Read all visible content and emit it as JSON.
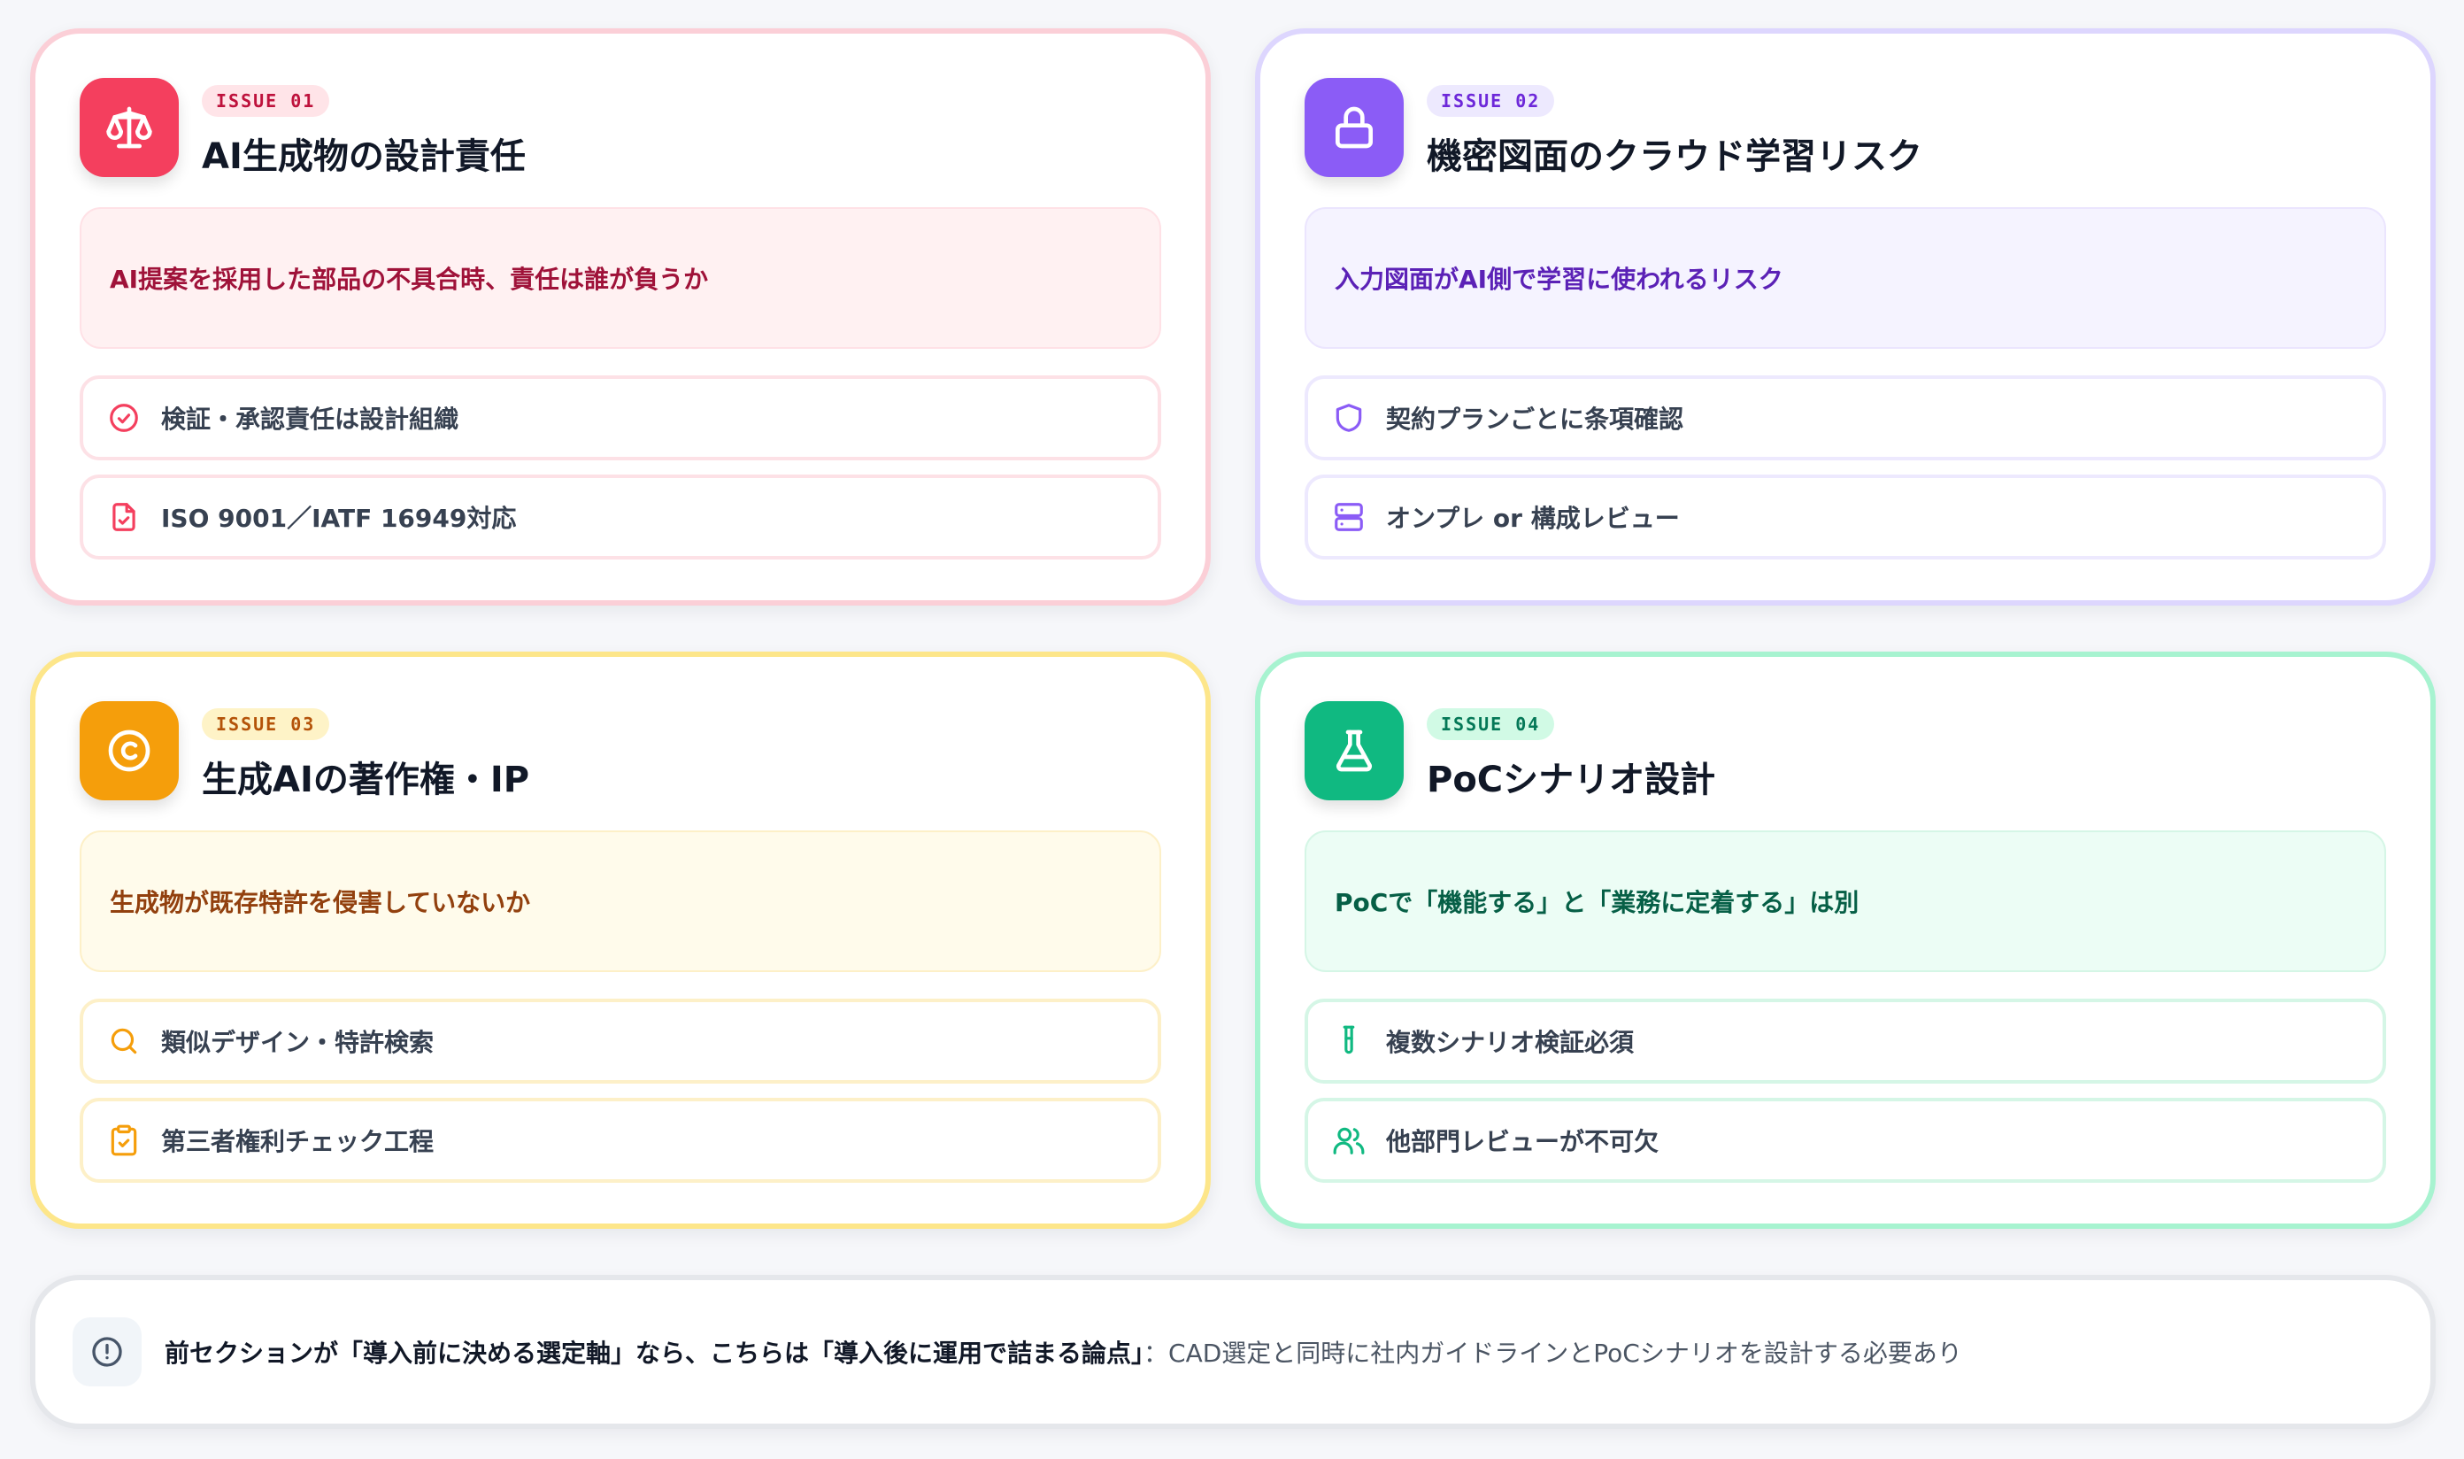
{
  "colors": {
    "issue01": "#f43f5e",
    "issue02": "#8b5cf6",
    "issue03": "#f59e0b",
    "issue04": "#10b981"
  },
  "cards": [
    {
      "badge": "ISSUE 01",
      "title": "AI生成物の設計責任",
      "icon": "scale-icon",
      "highlight": "AI提案を採用した部品の不具合時、責任は誰が負うか",
      "points": [
        {
          "icon": "check-circle-icon",
          "text": "検証・承認責任は設計組織"
        },
        {
          "icon": "file-check-icon",
          "text": "ISO 9001／IATF 16949対応"
        }
      ]
    },
    {
      "badge": "ISSUE 02",
      "title": "機密図面のクラウド学習リスク",
      "icon": "lock-icon",
      "highlight": "入力図面がAI側で学習に使われるリスク",
      "points": [
        {
          "icon": "shield-icon",
          "text": "契約プランごとに条項確認"
        },
        {
          "icon": "server-icon",
          "text": "オンプレ or 構成レビュー"
        }
      ]
    },
    {
      "badge": "ISSUE 03",
      "title": "生成AIの著作権・IP",
      "icon": "copyright-icon",
      "highlight": "生成物が既存特許を侵害していないか",
      "points": [
        {
          "icon": "search-icon",
          "text": "類似デザイン・特許検索"
        },
        {
          "icon": "clipboard-check-icon",
          "text": "第三者権利チェック工程"
        }
      ]
    },
    {
      "badge": "ISSUE 04",
      "title": "PoCシナリオ設計",
      "icon": "flask-icon",
      "highlight": "PoCで「機能する」と「業務に定着する」は別",
      "points": [
        {
          "icon": "test-tube-icon",
          "text": "複数シナリオ検証必須"
        },
        {
          "icon": "users-icon",
          "text": "他部門レビューが不可欠"
        }
      ]
    }
  ],
  "note": {
    "icon": "alert-circle-icon",
    "strong": "前セクションが「導入前に決める選定軸」なら、こちらは「導入後に運用で詰まる論点」",
    "rest": "：CAD選定と同時に社内ガイドラインとPoCシナリオを設計する必要あり"
  }
}
